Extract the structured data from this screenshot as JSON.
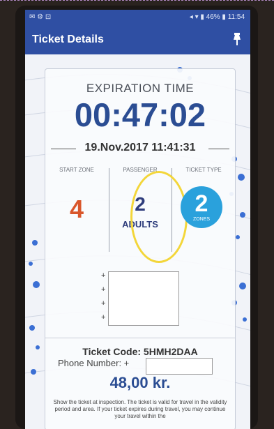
{
  "status_bar": {
    "left_icons": "✉ ⚙ ⊡",
    "right_text": "◂ ▾ ▮ 46% ▮ 11:54"
  },
  "app_bar": {
    "title": "Ticket Details",
    "action_icon": "pin-icon"
  },
  "ticket": {
    "expiration_label": "EXPIRATION TIME",
    "timer": "00:47:02",
    "expiry_datetime": "19.Nov.2017 11:41:31",
    "columns": {
      "start_zone": {
        "label": "START ZONE",
        "value": "4"
      },
      "passenger": {
        "label": "PASSENGER",
        "value": "2",
        "unit": "ADULTS"
      },
      "ticket_type": {
        "label": "TICKET TYPE",
        "value": "2",
        "unit": "ZONES"
      }
    },
    "code_line": "Ticket Code: 5HMH2DAA",
    "phone_label": "Phone Number: +",
    "price": "48,00 kr.",
    "note": "Show the ticket at inspection. The ticket is valid for travel in the validity period and area. If your ticket expires during travel, you may continue your travel within the"
  },
  "colors": {
    "app_bar": "#2f4fa3",
    "timer": "#2b4d93",
    "start_zone": "#d9562b",
    "zone_badge": "#2aa1dc",
    "highlight": "#f3d63a"
  }
}
